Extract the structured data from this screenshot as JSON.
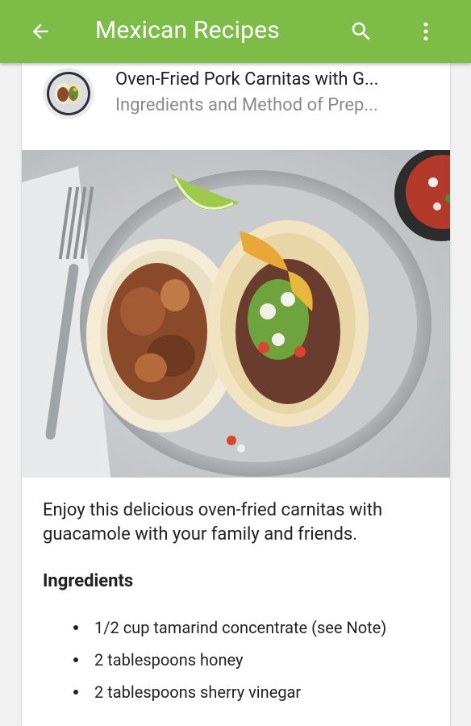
{
  "app_bar": {
    "title": "Mexican Recipes",
    "background_color": "#7cbc47",
    "back_icon": "arrow-back-icon",
    "search_icon": "search-icon",
    "more_icon": "more-vert-icon"
  },
  "recipe": {
    "title": "Oven-Fried Pork Carnitas with G...",
    "subtitle": "Ingredients and Method of Prep...",
    "intro": "Enjoy this delicious oven-fried carnitas with guacamole with your family and friends.",
    "ingredients_heading": "Ingredients",
    "ingredients": [
      "1/2 cup tamarind concentrate (see Note)",
      "2 tablespoons honey",
      "2 tablespoons sherry vinegar"
    ]
  }
}
